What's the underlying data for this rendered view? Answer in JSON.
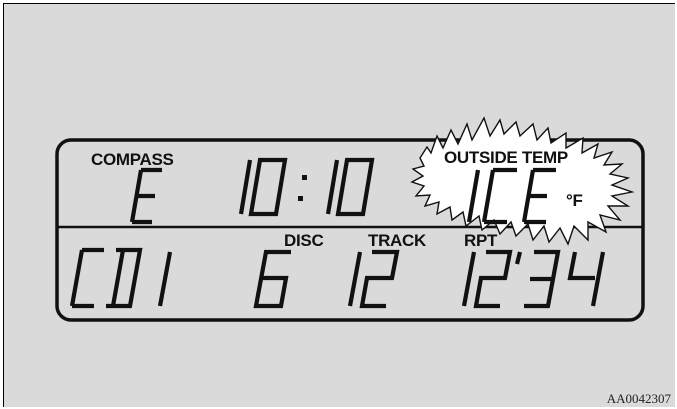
{
  "labels": {
    "compass": "COMPASS",
    "outside_temp": "OUTSIDE TEMP",
    "disc": "DISC",
    "track": "TRACK",
    "rpt": "RPT"
  },
  "readouts": {
    "compass_heading": "E",
    "clock": "10:10",
    "temperature": "ICE",
    "temp_unit": "°F",
    "source": "CD1",
    "disc_number": "6",
    "track_number": "12",
    "play_time": "12'34"
  },
  "figure_id": "AA0042307",
  "colors": {
    "background": "#dadada",
    "highlight": "#ffffff",
    "ink": "#111111"
  }
}
